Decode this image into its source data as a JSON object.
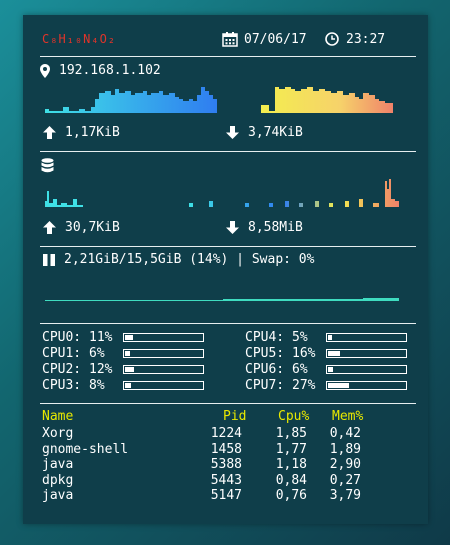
{
  "header": {
    "formula": "C₈H₁₀N₄O₂",
    "date": "07/06/17",
    "time": "23:27",
    "formula_color": "#e0342a"
  },
  "network": {
    "ip": "192.168.1.102",
    "upload": "1,17KiB",
    "download": "3,74KiB"
  },
  "disk": {
    "read": "30,7KiB",
    "write": "8,58MiB"
  },
  "memory": {
    "text": "2,21GiB/15,5GiB (14%) | Swap: 0%"
  },
  "cpu": [
    {
      "label": "CPU0:",
      "value": "11%",
      "level": 0.11
    },
    {
      "label": "CPU1:",
      "value": "6%",
      "level": 0.06
    },
    {
      "label": "CPU2:",
      "value": "12%",
      "level": 0.12
    },
    {
      "label": "CPU3:",
      "value": "8%",
      "level": 0.08
    },
    {
      "label": "CPU4:",
      "value": "5%",
      "level": 0.05
    },
    {
      "label": "CPU5:",
      "value": "16%",
      "level": 0.16
    },
    {
      "label": "CPU6:",
      "value": "6%",
      "level": 0.06
    },
    {
      "label": "CPU7:",
      "value": "27%",
      "level": 0.27
    }
  ],
  "processes": {
    "headers": {
      "name": "Name",
      "pid": "Pid",
      "cpu": "Cpu%",
      "mem": "Mem%"
    },
    "header_color": "#e8e800",
    "rows": [
      {
        "name": "Xorg",
        "pid": "1224",
        "cpu": "1,85",
        "mem": "0,42"
      },
      {
        "name": "gnome-shell",
        "pid": "1458",
        "cpu": "1,77",
        "mem": "1,89"
      },
      {
        "name": "java",
        "pid": "5388",
        "cpu": "1,18",
        "mem": "2,90"
      },
      {
        "name": "dpkg",
        "pid": "5443",
        "cpu": "0,84",
        "mem": "0,27"
      },
      {
        "name": "java",
        "pid": "5147",
        "cpu": "0,76",
        "mem": "3,79"
      }
    ]
  },
  "icons": {
    "calendar": "calendar-icon",
    "clock": "clock-icon",
    "location": "map-marker-icon",
    "upload": "arrow-up-icon",
    "download": "arrow-down-icon",
    "disk": "database-icon",
    "memory": "memory-icon"
  },
  "colors": {
    "panel_bg": "#0f3e4a",
    "graph_cyan": "#3fe0e6",
    "graph_blue": "#2f7df0",
    "graph_yellow": "#f3ee4e",
    "graph_salmon": "#f0826a",
    "mem_graph": "#3fdcc0"
  }
}
